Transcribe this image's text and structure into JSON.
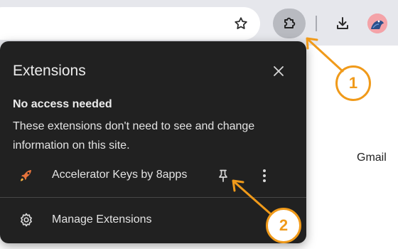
{
  "page": {
    "gmail_label": "Gmail"
  },
  "toolbar": {
    "icons": [
      "bookmark-star-icon",
      "extensions-puzzle-icon",
      "download-icon",
      "profile-avatar"
    ]
  },
  "popup": {
    "title": "Extensions",
    "section_heading": "No access needed",
    "section_description": "These extensions don't need to see and change information on this site.",
    "extensions": [
      {
        "name": "Accelerator Keys by 8apps",
        "icon": "rocket-icon"
      }
    ],
    "manage_label": "Manage Extensions"
  },
  "annotations": {
    "callout_1": "1",
    "callout_2": "2",
    "color": "#f09a1a"
  },
  "colors": {
    "popup_bg": "#212121",
    "toolbar_bg": "#e6e7ec",
    "text": "#e3e3e3"
  }
}
